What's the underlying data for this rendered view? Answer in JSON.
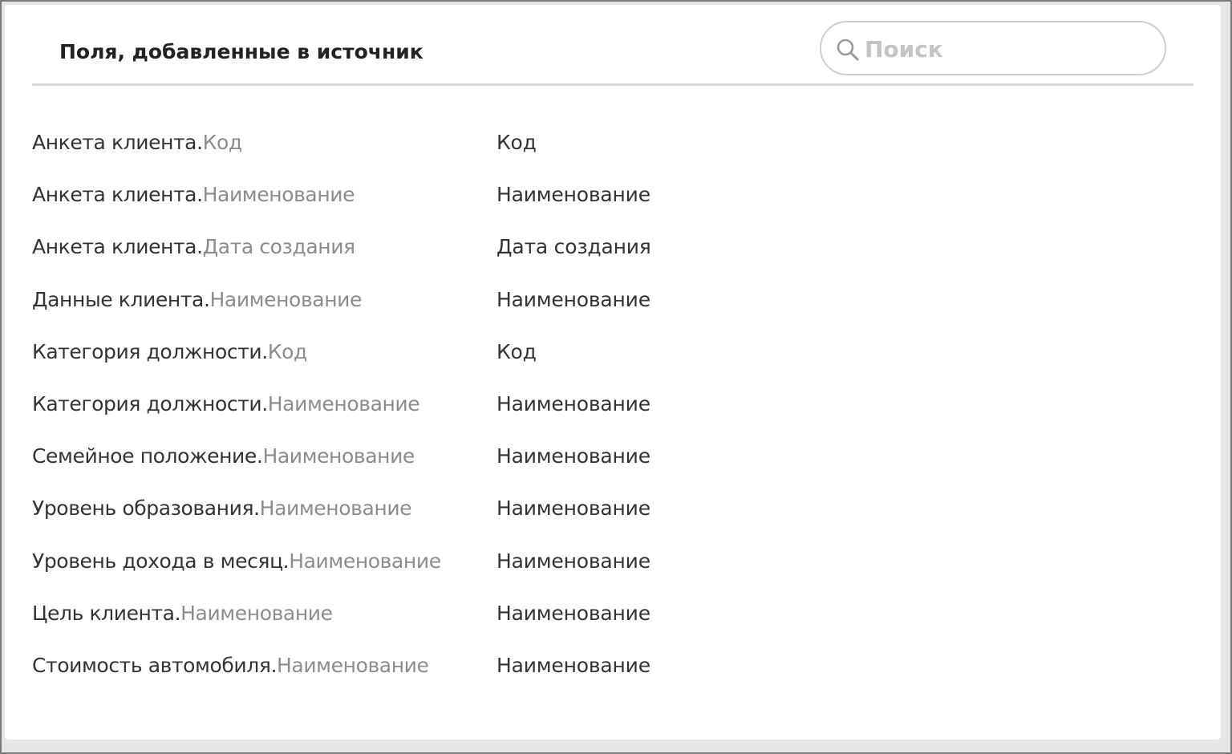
{
  "header": {
    "title": "Поля, добавленные в источник"
  },
  "search": {
    "placeholder": "Поиск",
    "value": "",
    "icon": "search-icon"
  },
  "fields": [
    {
      "entity": "Анкета клиента.",
      "field": "Код",
      "alias": "Код"
    },
    {
      "entity": "Анкета клиента.",
      "field": "Наименование",
      "alias": "Наименование"
    },
    {
      "entity": "Анкета клиента.",
      "field": "Дата создания",
      "alias": "Дата создания"
    },
    {
      "entity": "Данные клиента.",
      "field": "Наименование",
      "alias": "Наименование"
    },
    {
      "entity": "Категория должности.",
      "field": "Код",
      "alias": "Код"
    },
    {
      "entity": "Категория должности.",
      "field": "Наименование",
      "alias": "Наименование"
    },
    {
      "entity": "Семейное положение.",
      "field": "Наименование",
      "alias": "Наименование"
    },
    {
      "entity": "Уровень образования.",
      "field": "Наименование",
      "alias": "Наименование"
    },
    {
      "entity": "Уровень дохода в месяц.",
      "field": "Наименование",
      "alias": "Наименование"
    },
    {
      "entity": "Цель клиента.",
      "field": "Наименование",
      "alias": "Наименование"
    },
    {
      "entity": "Стоимость автомобиля.",
      "field": "Наименование",
      "alias": "Наименование"
    }
  ],
  "colors": {
    "entity_text": "#333333",
    "field_text": "#8c8c8c",
    "divider": "#d9d9d9",
    "search_border": "#cfcfcf"
  }
}
